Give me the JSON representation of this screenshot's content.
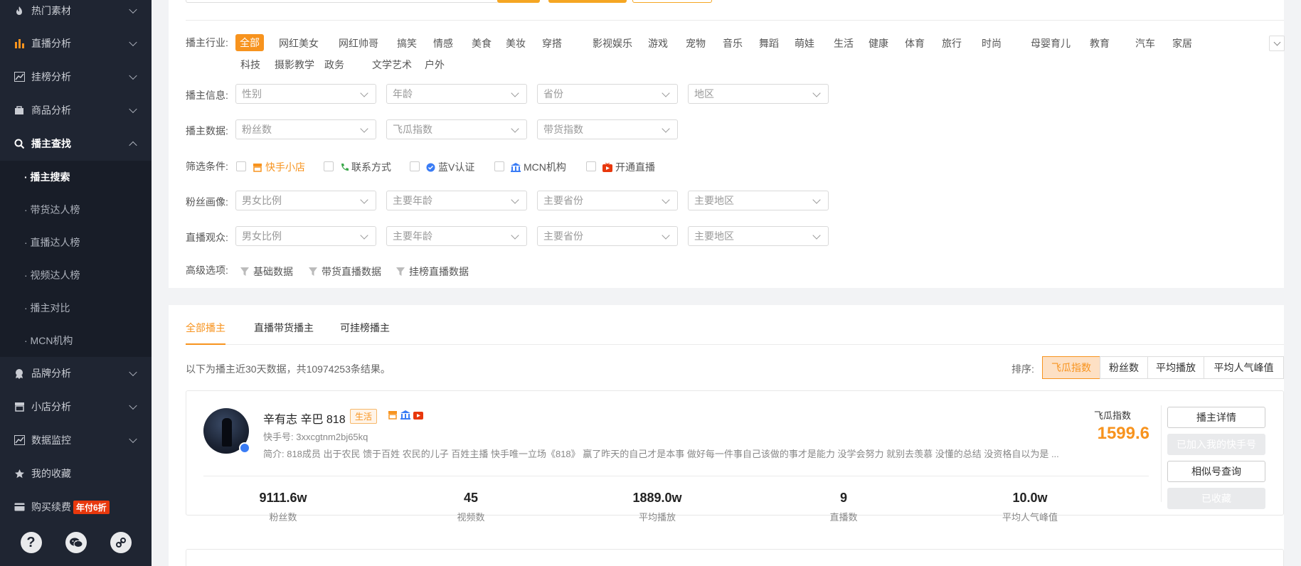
{
  "sidebar": {
    "items": [
      {
        "label": "热门素材",
        "icon": "fire-icon"
      },
      {
        "label": "直播分析",
        "icon": "bar-chart-icon"
      },
      {
        "label": "挂榜分析",
        "icon": "trend-chart-icon"
      },
      {
        "label": "商品分析",
        "icon": "bag-icon"
      },
      {
        "label": "播主查找",
        "icon": "search-icon"
      },
      {
        "label": "品牌分析",
        "icon": "award-icon"
      },
      {
        "label": "小店分析",
        "icon": "store-icon"
      },
      {
        "label": "数据监控",
        "icon": "monitor-chart-icon"
      },
      {
        "label": "我的收藏",
        "icon": "star-icon"
      },
      {
        "label": "购买续费",
        "icon": "card-icon"
      }
    ],
    "sub_items": [
      "· 播主搜索",
      "· 带货达人榜",
      "· 直播达人榜",
      "· 视频达人榜",
      "· 播主对比",
      "· MCN机构"
    ],
    "purchase_badge": "年付6折",
    "bottom_icons": [
      "help-icon",
      "wechat-icon",
      "link-icon"
    ]
  },
  "filters": {
    "industry_label": "播主行业:",
    "industry_tags_row1": [
      "全部",
      "网红美女",
      "网红帅哥",
      "搞笑",
      "情感",
      "美食",
      "美妆",
      "穿搭",
      "影视娱乐",
      "游戏",
      "宠物",
      "音乐",
      "舞蹈",
      "萌娃",
      "生活",
      "健康",
      "体育",
      "旅行",
      "时尚",
      "母婴育儿",
      "教育",
      "汽车",
      "家居"
    ],
    "industry_tags_row2": [
      "科技",
      "摄影教学",
      "政务",
      "文学艺术",
      "户外"
    ],
    "info_label": "播主信息:",
    "info_selects": [
      "性别",
      "年龄",
      "省份",
      "地区"
    ],
    "data_label": "播主数据:",
    "data_selects": [
      "粉丝数",
      "飞瓜指数",
      "带货指数"
    ],
    "conditions_label": "筛选条件:",
    "conditions": [
      "快手小店",
      "联系方式",
      "蓝V认证",
      "MCN机构",
      "开通直播"
    ],
    "fans_label": "粉丝画像:",
    "fans_selects": [
      "男女比例",
      "主要年龄",
      "主要省份",
      "主要地区"
    ],
    "audience_label": "直播观众:",
    "audience_selects": [
      "男女比例",
      "主要年龄",
      "主要省份",
      "主要地区"
    ],
    "advanced_label": "高级选项:",
    "advanced": [
      "基础数据",
      "带货直播数据",
      "挂榜直播数据"
    ]
  },
  "results": {
    "tabs": [
      "全部播主",
      "直播带货播主",
      "可挂榜播主"
    ],
    "summary": "以下为播主近30天数据，共10974253条结果。",
    "sort_label": "排序:",
    "sort_options": [
      "飞瓜指数",
      "粉丝数",
      "平均播放",
      "平均人气峰值"
    ],
    "card": {
      "name": "辛有志 辛巴 818",
      "category": "生活",
      "kuaishou_id": "快手号: 3xxcgtnm2bj65kq",
      "bio": "简介: 818成员 出于农民 馈于百姓 农民的儿子 百姓主播 快手唯一立场《818》 赢了昨天的自己才是本事 做好每一件事自己该做的事才是能力 没学会努力 就别去羡慕 没懂的总结 没资格自以为是 ...",
      "index_label": "飞瓜指数",
      "index_value": "1599.6",
      "stats": [
        {
          "value": "9111.6w",
          "label": "粉丝数"
        },
        {
          "value": "45",
          "label": "视频数"
        },
        {
          "value": "1889.0w",
          "label": "平均播放"
        },
        {
          "value": "9",
          "label": "直播数"
        },
        {
          "value": "10.0w",
          "label": "平均人气峰值"
        }
      ],
      "actions": [
        "播主详情",
        "已加入我的快手号",
        "相似号查询",
        "已收藏"
      ]
    }
  },
  "colors": {
    "accent": "#f7931e",
    "sidebar": "#1f2532",
    "badge_red": "#e8380d",
    "blue_v": "#3a7cf5"
  }
}
